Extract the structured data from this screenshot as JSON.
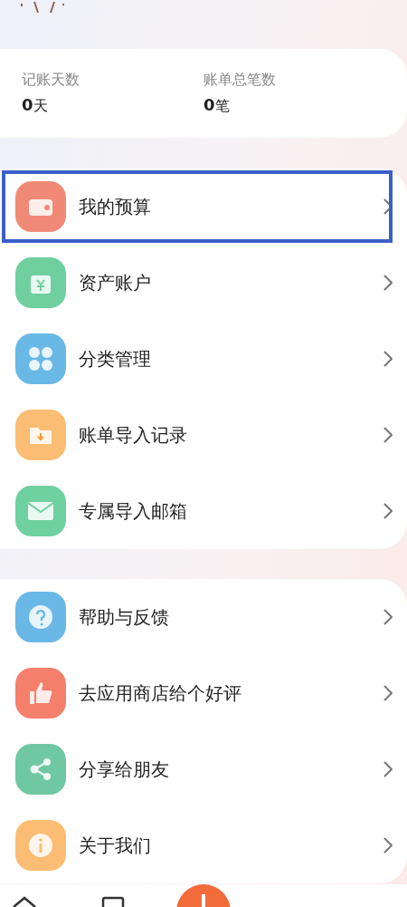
{
  "stats": [
    {
      "label": "记账天数",
      "value": "0",
      "unit": "天"
    },
    {
      "label": "账单总笔数",
      "value": "0",
      "unit": "笔"
    }
  ],
  "menu_groups": [
    {
      "items": [
        {
          "label": "我的预算",
          "kind": "wallet",
          "color": "#f08a76",
          "highlighted": true
        },
        {
          "label": "资产账户",
          "kind": "money",
          "color": "#6fcf9f",
          "highlighted": false
        },
        {
          "label": "分类管理",
          "kind": "grid",
          "color": "#6ab8e6",
          "highlighted": false
        },
        {
          "label": "账单导入记录",
          "kind": "folder",
          "color": "#fbbd74",
          "highlighted": false
        },
        {
          "label": "专属导入邮箱",
          "kind": "mail",
          "color": "#6fd0a0",
          "highlighted": false
        }
      ]
    },
    {
      "items": [
        {
          "label": "帮助与反馈",
          "kind": "help",
          "color": "#6ab8e6",
          "highlighted": false
        },
        {
          "label": "去应用商店给个好评",
          "kind": "thumb",
          "color": "#f47f6b",
          "highlighted": false
        },
        {
          "label": "分享给朋友",
          "kind": "share",
          "color": "#6fc8a2",
          "highlighted": false
        },
        {
          "label": "关于我们",
          "kind": "info",
          "color": "#fbbd74",
          "highlighted": false
        }
      ]
    }
  ]
}
